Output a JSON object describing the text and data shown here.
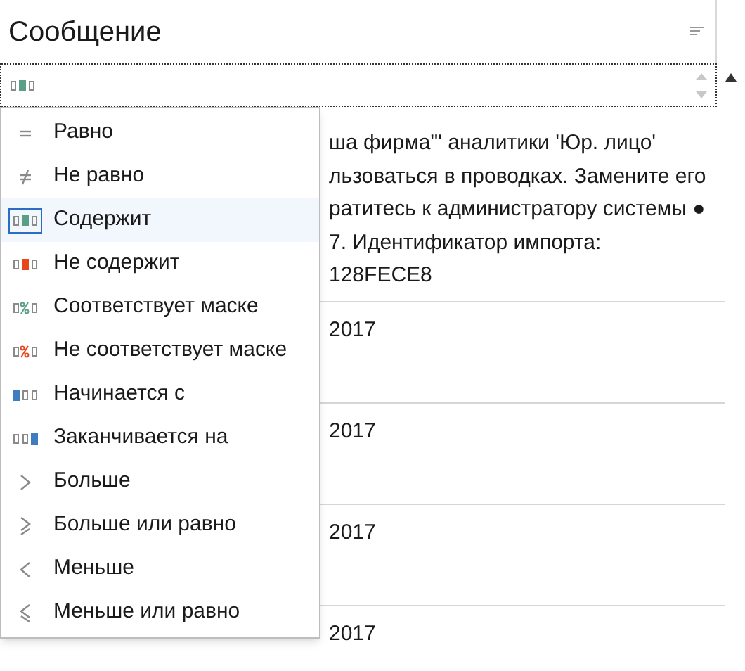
{
  "column": {
    "title": "Сообщение"
  },
  "filter": {
    "kind": "contains"
  },
  "operators": [
    {
      "label": "Равно",
      "kind": "equals",
      "selected": false
    },
    {
      "label": "Не равно",
      "kind": "not-equals",
      "selected": false
    },
    {
      "label": "Содержит",
      "kind": "contains",
      "selected": true
    },
    {
      "label": "Не содержит",
      "kind": "not-contains",
      "selected": false
    },
    {
      "label": "Соответствует маске",
      "kind": "like",
      "selected": false
    },
    {
      "label": "Не соответствует маске",
      "kind": "not-like",
      "selected": false
    },
    {
      "label": "Начинается с",
      "kind": "starts",
      "selected": false
    },
    {
      "label": "Заканчивается на",
      "kind": "ends",
      "selected": false
    },
    {
      "label": "Больше",
      "kind": "greater",
      "selected": false
    },
    {
      "label": "Больше или равно",
      "kind": "greater-equal",
      "selected": false
    },
    {
      "label": "Меньше",
      "kind": "less",
      "selected": false
    },
    {
      "label": "Меньше или равно",
      "kind": "less-equal",
      "selected": false
    }
  ],
  "rows": [
    {
      "lines": [
        "ша фирма\"' аналитики 'Юр. лицо'",
        "льзоваться в проводках. Замените его",
        "ратитесь к администратору системы ●",
        "7. Идентификатор импорта:",
        "128FECE8"
      ]
    },
    {
      "lines": [
        "2017"
      ]
    },
    {
      "lines": [
        "2017"
      ]
    },
    {
      "lines": [
        "2017"
      ]
    },
    {
      "lines": [
        "2017"
      ]
    }
  ]
}
